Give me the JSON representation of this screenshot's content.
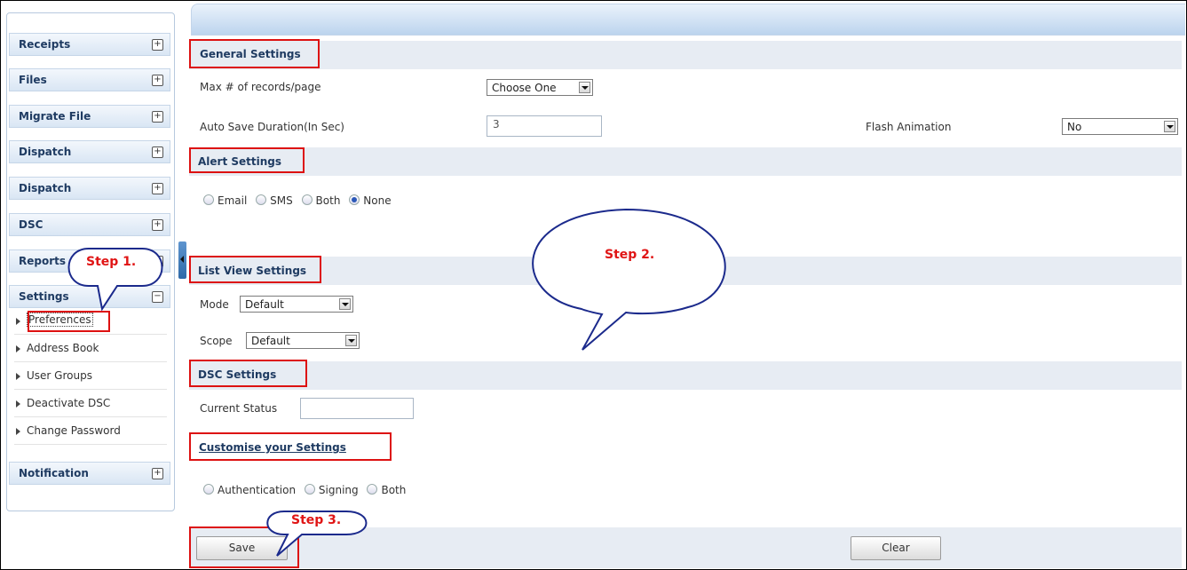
{
  "sidebar": {
    "headers": [
      {
        "label": "Receipts",
        "toggle": "+"
      },
      {
        "label": "Files",
        "toggle": "+"
      },
      {
        "label": "Migrate File",
        "toggle": "+"
      },
      {
        "label": "Dispatch",
        "toggle": "+"
      },
      {
        "label": "Dispatch",
        "toggle": "+"
      },
      {
        "label": "DSC",
        "toggle": "+"
      },
      {
        "label": "Reports",
        "toggle": "+"
      },
      {
        "label": "Settings",
        "toggle": "−"
      }
    ],
    "settings_items": [
      "Preferences",
      "Address Book",
      "User Groups",
      "Deactivate DSC",
      "Change Password"
    ],
    "notification": {
      "label": "Notification",
      "toggle": "+"
    }
  },
  "general": {
    "title": "General Settings",
    "max_records_label": "Max # of records/page",
    "max_records_value": "Choose One",
    "autosave_label": "Auto Save Duration(In Sec)",
    "autosave_value": "3",
    "flash_label": "Flash Animation",
    "flash_value": "No"
  },
  "alert": {
    "title": "Alert Settings",
    "options": [
      "Email",
      "SMS",
      "Both",
      "None"
    ],
    "selected": "None"
  },
  "listview": {
    "title": "List View Settings",
    "mode_label": "Mode",
    "mode_value": "Default",
    "scope_label": "Scope",
    "scope_value": "Default"
  },
  "dsc": {
    "title": "DSC Settings",
    "status_label": "Current Status",
    "status_value": ""
  },
  "customise": {
    "title": "Customise your Settings",
    "options": [
      "Authentication",
      "Signing",
      "Both"
    ]
  },
  "buttons": {
    "save": "Save",
    "clear": "Clear"
  },
  "annotations": {
    "step1": "Step 1.",
    "step2": "Step 2.",
    "step3": "Step 3."
  },
  "colors": {
    "annotation": "#e01515",
    "bubble_outline": "#1b2a8c",
    "section_title": "#1f3b62",
    "band": "#e7ecf3"
  }
}
